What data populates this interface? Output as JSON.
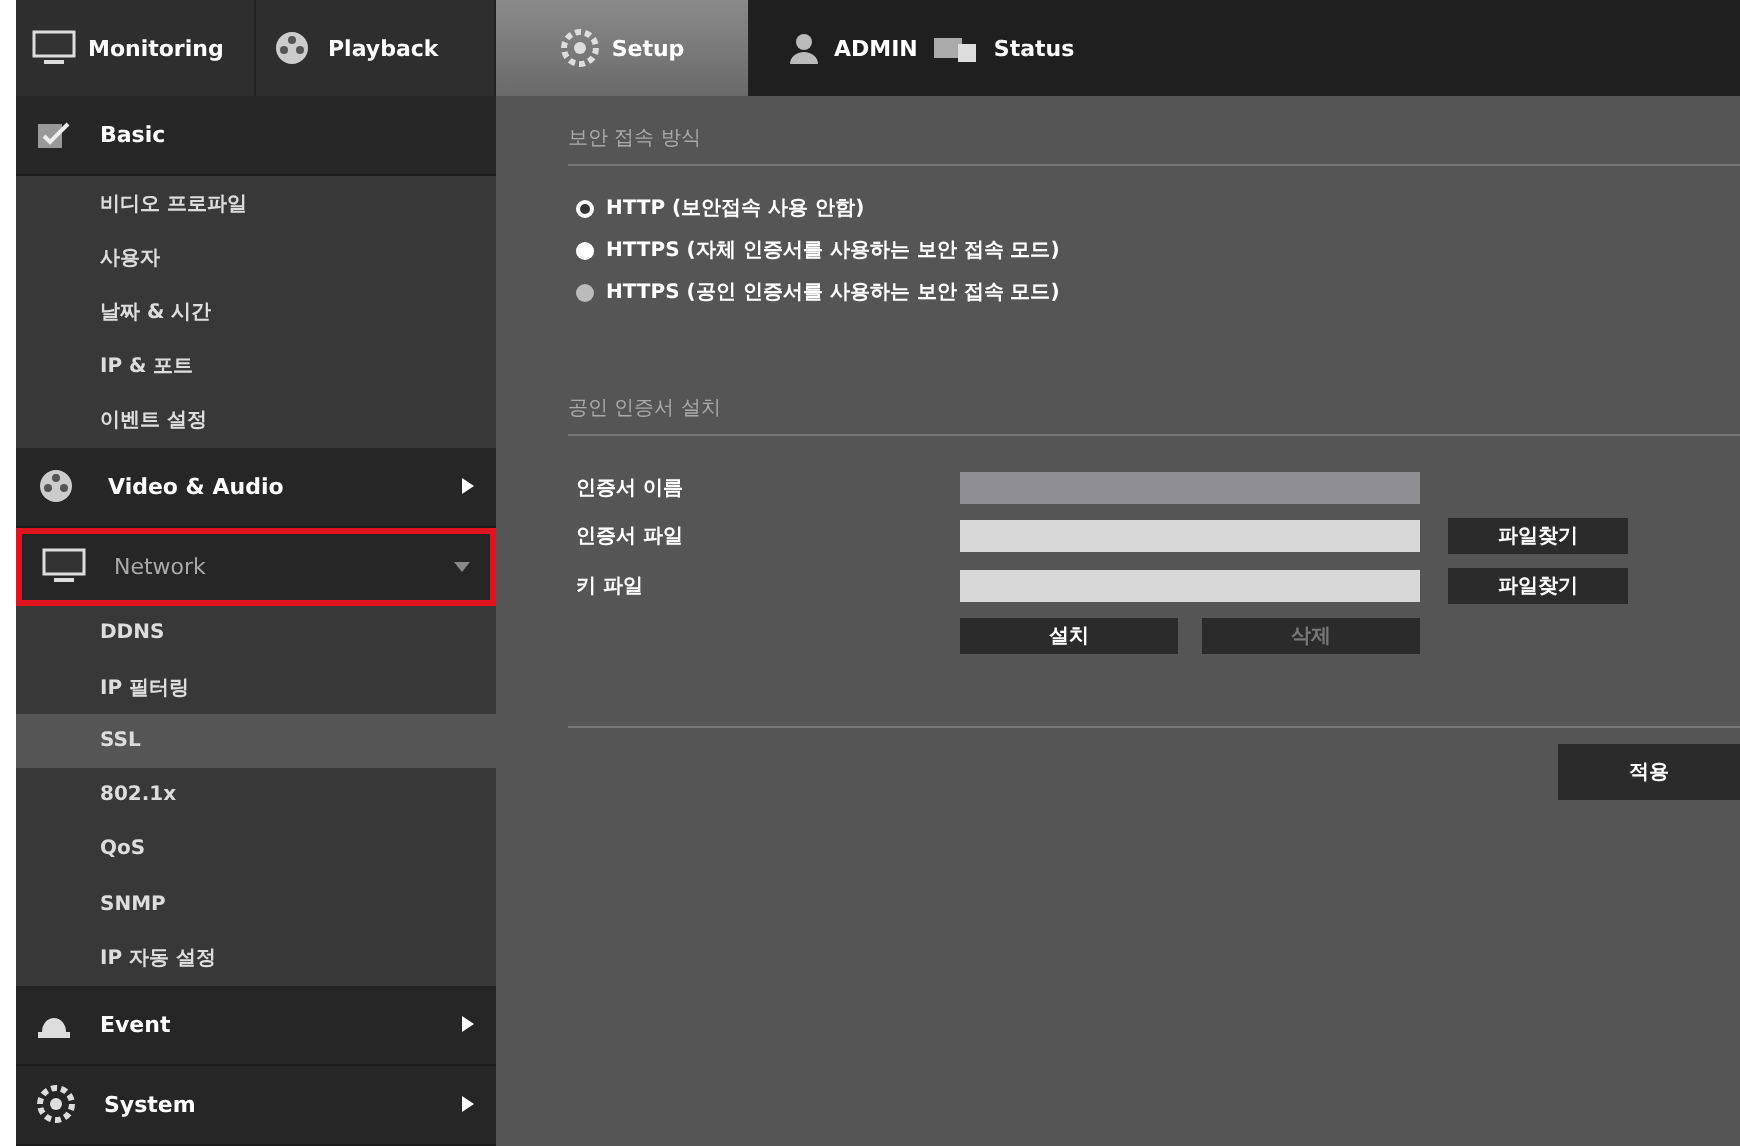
{
  "top_tabs": [
    {
      "label": "Monitoring",
      "selected": false
    },
    {
      "label": "Playback",
      "selected": false
    },
    {
      "label": "Setup",
      "selected": true
    }
  ],
  "user": {
    "label": "ADMIN"
  },
  "status": {
    "label": "Status"
  },
  "sidebar": {
    "groups": [
      {
        "label": "Basic",
        "expanded": true,
        "highlighted": false,
        "children": [
          {
            "label": "비디오 프로파일",
            "selected": false
          },
          {
            "label": "사용자",
            "selected": false
          },
          {
            "label": "날짜 & 시간",
            "selected": false
          },
          {
            "label": "IP & 포트",
            "selected": false
          },
          {
            "label": "이벤트 설정",
            "selected": false
          }
        ]
      },
      {
        "label": "Video & Audio",
        "expanded": false,
        "highlighted": false
      },
      {
        "label": "Network",
        "expanded": true,
        "highlighted": true,
        "children": [
          {
            "label": "DDNS",
            "selected": false
          },
          {
            "label": "IP 필터링",
            "selected": false
          },
          {
            "label": "SSL",
            "selected": true
          },
          {
            "label": "802.1x",
            "selected": false
          },
          {
            "label": "QoS",
            "selected": false
          },
          {
            "label": "SNMP",
            "selected": false
          },
          {
            "label": "IP 자동 설정",
            "selected": false
          }
        ]
      },
      {
        "label": "Event",
        "expanded": false,
        "highlighted": false
      },
      {
        "label": "System",
        "expanded": false,
        "highlighted": false
      }
    ]
  },
  "security_mode": {
    "title": "보안 접속 방식",
    "options": [
      {
        "label": "HTTP (보안접속 사용 안함)",
        "selected": true,
        "disabled": false
      },
      {
        "label": "HTTPS (자체 인증서를 사용하는 보안 접속 모드)",
        "selected": false,
        "disabled": false
      },
      {
        "label": "HTTPS (공인 인증서를 사용하는 보안 접속 모드)",
        "selected": false,
        "disabled": true
      }
    ]
  },
  "certificate": {
    "title": "공인 인증서 설치",
    "fields": [
      {
        "label": "인증서 이름",
        "disabled": true
      },
      {
        "label": "인증서 파일",
        "disabled": false,
        "button": "파일찾기"
      },
      {
        "label": "키 파일",
        "disabled": false,
        "button": "파일찾기"
      }
    ],
    "buttons": [
      {
        "label": "설치",
        "disabled": false
      },
      {
        "label": "삭제",
        "disabled": true
      }
    ]
  },
  "apply_button": "적용"
}
